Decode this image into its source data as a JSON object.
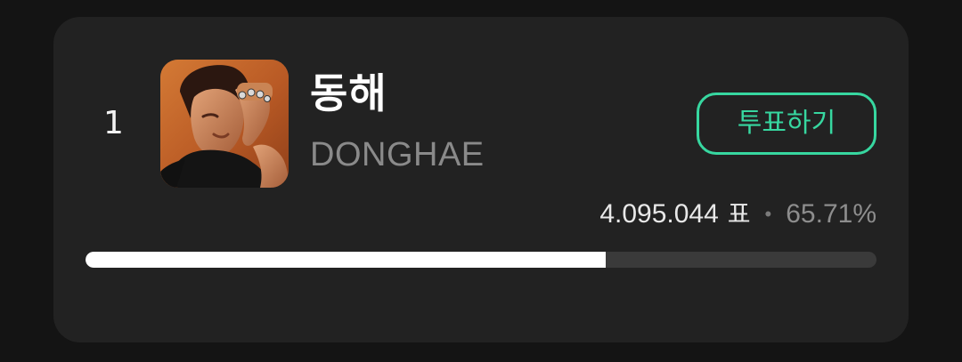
{
  "entry": {
    "rank": "1",
    "name": "동해",
    "subname": "DONGHAE",
    "vote_button_label": "투표하기",
    "votes": "4.095.044",
    "votes_unit": "표",
    "separator": "•",
    "percent_label": "65.71%",
    "percent_value": 65.71
  },
  "colors": {
    "background": "#141414",
    "card": "#222222",
    "accent": "#37d7a0",
    "bar_fill": "#ffffff",
    "bar_track": "#3a3a3a"
  }
}
